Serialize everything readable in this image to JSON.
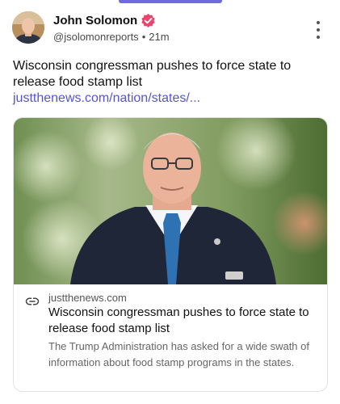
{
  "post": {
    "author_name": "John Solomon",
    "handle": "@jsolomonreports",
    "separator": "•",
    "time_ago": "21m",
    "text": "Wisconsin congressman pushes to force state to release food stamp list",
    "link_text": "justthenews.com/nation/states/...",
    "accent_color": "#5454d4",
    "verified_color": "#e8466d"
  },
  "card": {
    "domain": "justthenews.com",
    "title": "Wisconsin congressman pushes to force state to release food stamp list",
    "description": "The Trump Administration has asked for a wide swath of information about food stamp programs in the states."
  },
  "icons": [
    "verified-badge-icon",
    "more-options-icon",
    "link-icon"
  ]
}
